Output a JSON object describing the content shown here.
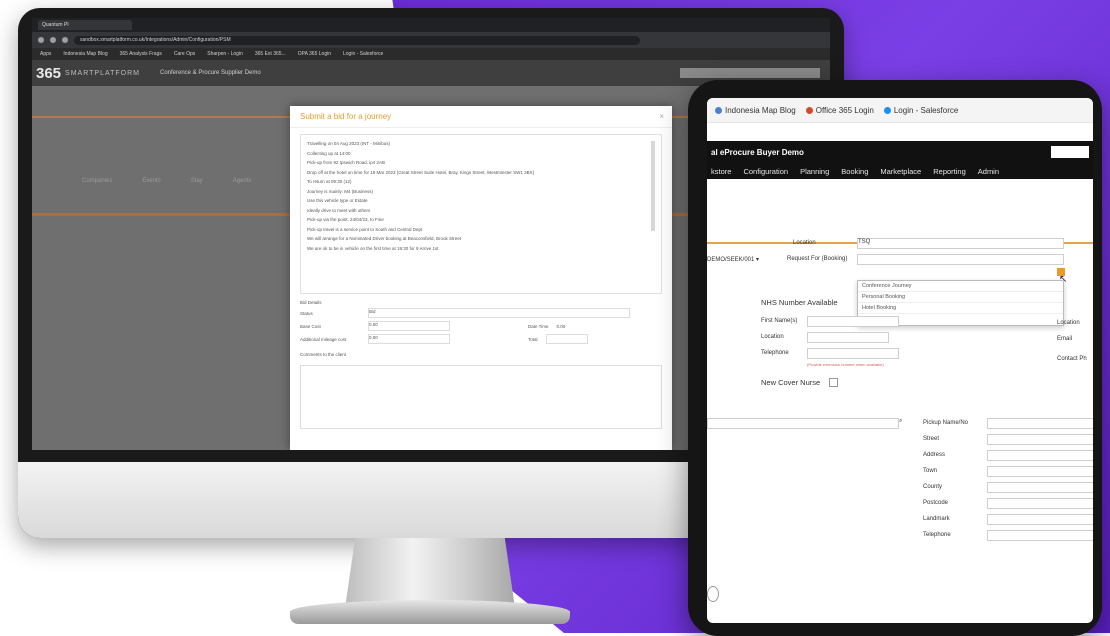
{
  "colors": {
    "purple": "#6a2ad6",
    "orange": "#e2a44e",
    "modal_title": "#e0a030"
  },
  "monitor": {
    "browser": {
      "tab": "Quantum PI",
      "url": "sandbox.smartplatform.co.uk/Integrations/Admin/Configuration/PSM",
      "bookmarks": [
        "Apps",
        "Indonesia Map Blog",
        "365 Analysis Frags",
        "Care Ops",
        "Sharpen - Login",
        "365 Ext 365...",
        "OPA 365 Login",
        "Login - Salesforce"
      ]
    },
    "app": {
      "logo": "365",
      "logo_sub": "SMARTPLATFORM",
      "title": "Conference & Procure Supplier Demo",
      "body_items": [
        "Companies",
        "Events",
        "Stay",
        "Agents"
      ]
    },
    "modal": {
      "title": "Submit a bid for a journey",
      "close": "×",
      "lines": [
        "Travelling on 04 Aug 2023 (INT - Minibus)",
        "Collecting up at 14:00",
        "Pick-up from 92 Ipswich Road, ip4 2AB",
        "Drop off at the hotel on time for 19 Mar 2023 (Great Street Suite Hotel, Bray, Kings Street, Westminster SW1 3BX)",
        "To return at 09:30 (12)",
        "Journey is mainly: M4 (Business)",
        "Use this vehicle type or Estate",
        "Ideally drive to meet with others",
        "Pick-up via the point: 24/04/23, to Fine",
        "Pick-up travel is a service point to South and Central Dept",
        "We will arrange for a Nominated Driver booking at Beaconsfield, Brook Street",
        "We are ok to be in vehicle on the first time at 19:30 for 9 Arrive 1st"
      ],
      "bid_heading": "Bid Details",
      "fields": {
        "status_label": "Status",
        "status_value": "Bid",
        "base_cost_label": "Base Cost",
        "base_cost_value": "0.00",
        "date_time_label": "Date Time",
        "date_time_value": "0.00",
        "additional_label": "Additional mileage cost",
        "additional_value": "0.00",
        "total_label": "Total",
        "total_value": ""
      },
      "comment_label": "Comments to the client"
    }
  },
  "tablet": {
    "bookmarks": [
      {
        "label": "Indonesia Map Blog",
        "icon": "globe-icon",
        "color": "#4a7fd4"
      },
      {
        "label": "Office 365 Login",
        "icon": "office-icon",
        "color": "#d14b2a"
      },
      {
        "label": "Login - Salesforce",
        "icon": "cloud-icon",
        "color": "#1b8ff2"
      }
    ],
    "title": "al eProcure Buyer Demo",
    "nav": [
      "kstore",
      "Configuration",
      "Planning",
      "Booking",
      "Marketplace",
      "Reporting",
      "Admin"
    ],
    "form": {
      "location_label": "Location",
      "location_value": "TSQ",
      "request_label": "Request For (Booking)",
      "left_select": "DEMO/SEEK/001 ▾",
      "dropdown_items": [
        "Conference Journey",
        "Personal Booking",
        "Hotel Booking"
      ],
      "nhs_label": "NHS Number Available",
      "first_name_label": "First Name(s)",
      "location2_label": "Location",
      "telephone_label": "Telephone",
      "telephone_hint": "(Provide extension number when available)",
      "new_cover_label": "New Cover Nurse",
      "pickup_label": "Pickup Name/No",
      "street_label": "Street",
      "address_label": "Address",
      "town_label": "Town",
      "county_label": "County",
      "postcode_label": "Postcode",
      "landmark_label": "Landmark",
      "telephone2_label": "Telephone",
      "right_labels": [
        "Location",
        "Email",
        "Contact Ph"
      ]
    }
  }
}
